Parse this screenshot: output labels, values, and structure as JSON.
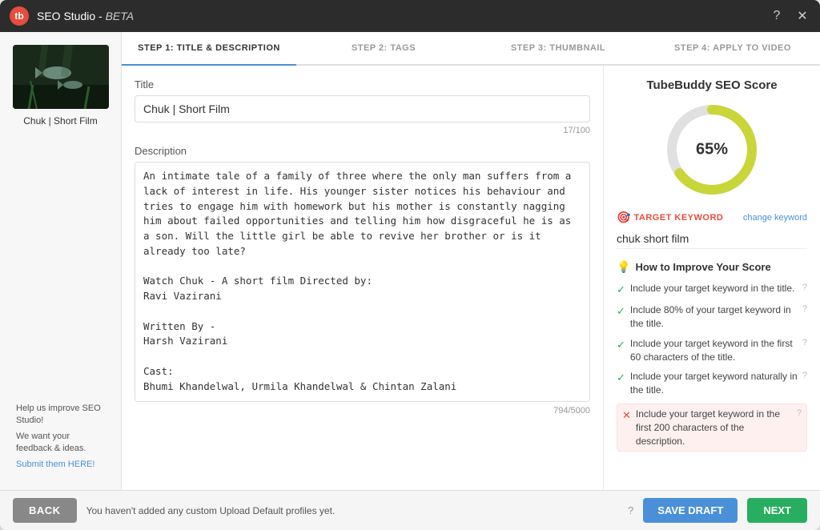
{
  "titleBar": {
    "logoText": "tb",
    "appName": "SEO Studio - ",
    "betaLabel": "BETA",
    "helpIcon": "?",
    "closeIcon": "✕"
  },
  "steps": [
    {
      "id": "step1",
      "label": "STEP 1:  TITLE & DESCRIPTION",
      "active": true
    },
    {
      "id": "step2",
      "label": "STEP 2:  TAGS",
      "active": false
    },
    {
      "id": "step3",
      "label": "STEP 3:  THUMBNAIL",
      "active": false
    },
    {
      "id": "step4",
      "label": "STEP 4:  APPLY TO VIDEO",
      "active": false
    }
  ],
  "videoLabel": "Chuk | Short Film",
  "feedback": {
    "line1": "Help us improve SEO Studio!",
    "line2": "We want your feedback & ideas.",
    "linkText": "Submit them HERE!"
  },
  "form": {
    "titleLabel": "Title",
    "titleValue": "Chuk | Short Film",
    "titleCharCount": "17/100",
    "descriptionLabel": "Description",
    "descriptionCharCount": "794/5000",
    "descriptionText": "An intimate tale of a family of three where the only man suffers from a lack of interest in life. His younger sister notices his behaviour and tries to engage him with homework but his mother is constantly nagging him about failed opportunities and telling him how disgraceful he is as a son. Will the little girl be able to revive her brother or is it already too late?\n\nWatch Chuk - A short film Directed by:\nRavi Vazirani\n\nWritten By -\nHarsh Vazirani\n\nCast:\nBhumi Khandelwal, Urmila Khandelwal & Chintan Zalani\n\nPost Production:\nwww.lightbulbstories.com\n\nFollow us on social media:\n\nFacebook:"
  },
  "seo": {
    "title": "TubeBuddy SEO Score",
    "scorePercent": 65,
    "scoreLabel": "65%",
    "donutRadius": 50,
    "donutCircumference": 314.16,
    "donutFill": 204.2,
    "targetKeywordLabel": "TARGET KEYWORD",
    "changeKeywordLabel": "change keyword",
    "keywordValue": "chuk short film",
    "improveTitle": "How to Improve Your Score",
    "items": [
      {
        "status": "pass",
        "text": "Include your target keyword in the title."
      },
      {
        "status": "pass",
        "text": "Include 80% of your target keyword in the title."
      },
      {
        "status": "pass",
        "text": "Include your target keyword in the first 60 characters of the title."
      },
      {
        "status": "pass",
        "text": "Include your target keyword naturally in the title."
      },
      {
        "status": "fail",
        "text": "Include your target keyword in the first 200 characters of the description."
      }
    ]
  },
  "bottomBar": {
    "backLabel": "BACK",
    "message": "You haven't added any custom Upload Default profiles yet.",
    "saveDraftLabel": "SAVE DRAFT",
    "nextLabel": "NEXT"
  }
}
